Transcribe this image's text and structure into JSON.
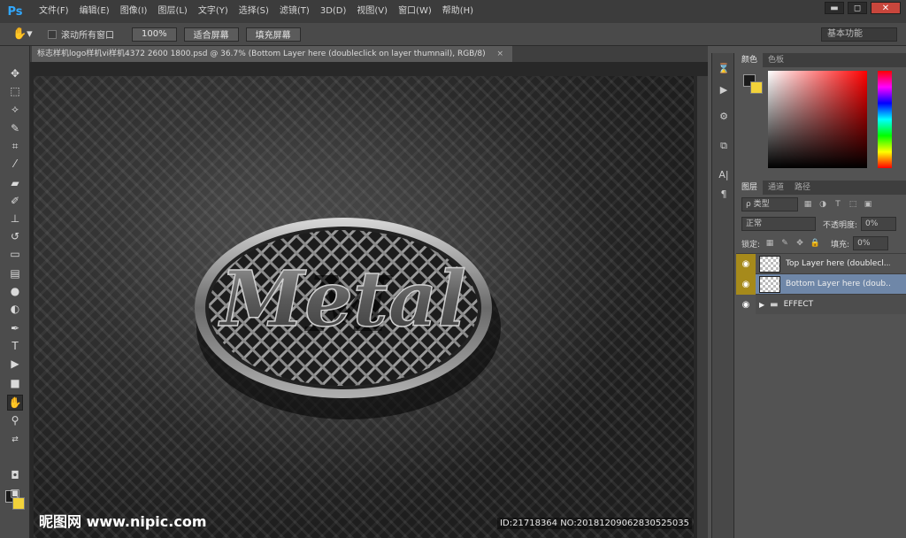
{
  "app": {
    "logo": "Ps"
  },
  "menu": [
    "文件(F)",
    "编辑(E)",
    "图像(I)",
    "图层(L)",
    "文字(Y)",
    "选择(S)",
    "滤镜(T)",
    "3D(D)",
    "视图(V)",
    "窗口(W)",
    "帮助(H)"
  ],
  "window_controls": {
    "minimize": "▬",
    "restore": "◻",
    "close": "✕"
  },
  "options": {
    "scroll_all_label": "滚动所有窗口",
    "btn_100": "100%",
    "btn_fit": "适合屏幕",
    "btn_fill": "填充屏幕",
    "workspace": "基本功能"
  },
  "document": {
    "tab_title": "标志样机logo样机vi样机4372 2600 1800.psd @ 36.7% (Bottom Layer here (doubleclick on layer thumnail), RGB/8)",
    "tab_close": "×",
    "logo_text": "Metal"
  },
  "overlay": {
    "watermark": "昵图网 www.nipic.com",
    "id_text": "ID:21718364 NO:20181209062830525035"
  },
  "color_panel": {
    "tabs": [
      "颜色",
      "色板"
    ]
  },
  "layers_panel": {
    "tabs": [
      "图层",
      "通道",
      "路径"
    ],
    "filter_kind": "ρ 类型",
    "blend_mode": "正常",
    "opacity_label": "不透明度:",
    "opacity_value": "0%",
    "lock_label": "锁定:",
    "fill_label": "填充:",
    "fill_value": "0%",
    "layers": [
      {
        "name": "Top Layer here (doublecl...",
        "visible": true,
        "selected": false
      },
      {
        "name": "Bottom Layer here (doub...",
        "visible": true,
        "selected": true
      },
      {
        "name": "EFFECT",
        "visible": false,
        "selected": false
      }
    ]
  },
  "colors": {
    "accent": "#31a8ff",
    "selection": "#6f87a8",
    "eye_bg": "#a68a1b",
    "fg": "#1a1a1a",
    "bg": "#f2d23a"
  }
}
